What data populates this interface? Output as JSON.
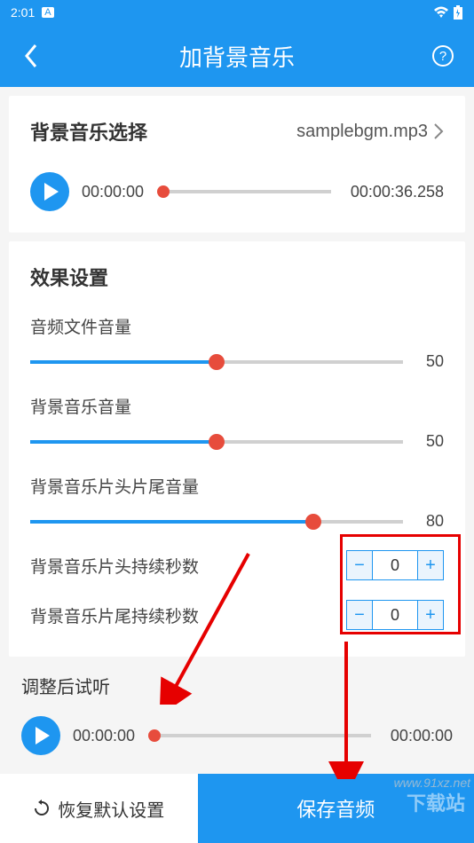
{
  "status": {
    "time": "2:01",
    "icon": "A"
  },
  "header": {
    "title": "加背景音乐"
  },
  "bgm": {
    "select_label": "背景音乐选择",
    "filename": "samplebgm.mp3",
    "player": {
      "current": "00:00:00",
      "total": "00:00:36.258",
      "progress_pct": 0
    }
  },
  "effects": {
    "title": "效果设置",
    "sliders": [
      {
        "label": "音频文件音量",
        "value": 50,
        "pct": 50
      },
      {
        "label": "背景音乐音量",
        "value": 50,
        "pct": 50
      },
      {
        "label": "背景音乐片头片尾音量",
        "value": 80,
        "pct": 76
      }
    ],
    "steppers": [
      {
        "label": "背景音乐片头持续秒数",
        "value": 0
      },
      {
        "label": "背景音乐片尾持续秒数",
        "value": 0
      }
    ]
  },
  "preview": {
    "title": "调整后试听",
    "current": "00:00:00",
    "total": "00:00:00",
    "progress_pct": 0
  },
  "footer": {
    "reset": "恢复默认设置",
    "save": "保存音频"
  },
  "watermark": {
    "small": "www.91xz.net",
    "big": "下载站"
  }
}
